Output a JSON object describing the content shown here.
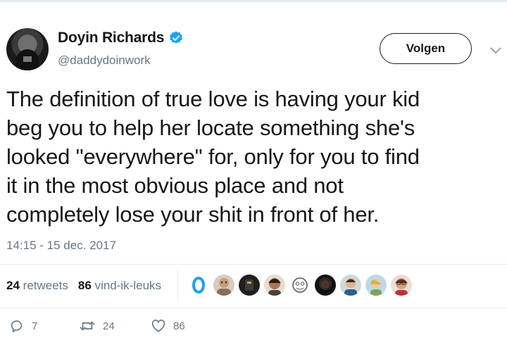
{
  "author": {
    "display_name": "Doyin Richards",
    "handle": "@daddydoinwork",
    "verified": true
  },
  "header": {
    "follow_label": "Volgen"
  },
  "tweet": {
    "text_lines": [
      "The definition of true love is having your kid",
      "beg you to help her locate something she's",
      "looked \"everywhere\" for, only for you to find",
      "it in the most obvious place and not",
      "completely lose your shit in front of her."
    ],
    "timestamp": "14:15 - 15 dec. 2017"
  },
  "stats": {
    "retweets_count": "24",
    "retweets_label": "retweets",
    "likes_count": "86",
    "likes_label": "vind-ik-leuks",
    "liker_avatar_count": 9
  },
  "actions": {
    "reply_count": "7",
    "retweet_count": "24",
    "like_count": "86"
  },
  "colors": {
    "text": "#14171a",
    "secondary": "#657786",
    "verified_blue": "#1da1f2",
    "divider": "#e6ecf0"
  },
  "icons": [
    "verified-badge-icon",
    "chevron-down-icon",
    "reply-icon",
    "retweet-icon",
    "heart-icon"
  ]
}
